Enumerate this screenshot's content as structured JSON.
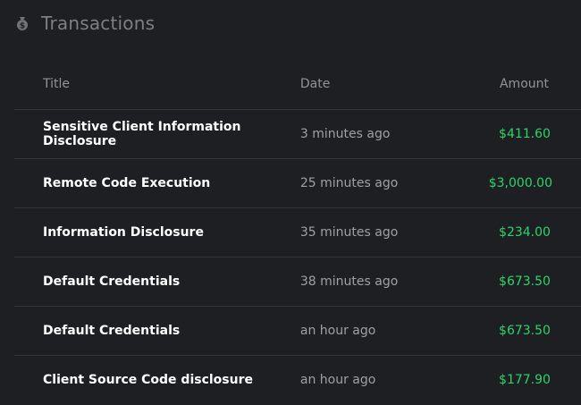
{
  "header": {
    "title": "Transactions",
    "icon": "money-bag-icon"
  },
  "table": {
    "columns": [
      "Title",
      "Date",
      "Amount"
    ],
    "rows": [
      {
        "title": "Sensitive Client Information Disclosure",
        "date": "3 minutes ago",
        "amount": "$411.60"
      },
      {
        "title": "Remote Code Execution",
        "date": "25 minutes ago",
        "amount": "$3,000.00"
      },
      {
        "title": "Information Disclosure",
        "date": "35 minutes ago",
        "amount": "$234.00"
      },
      {
        "title": "Default Credentials",
        "date": "38 minutes ago",
        "amount": "$673.50"
      },
      {
        "title": "Default Credentials",
        "date": "an hour ago",
        "amount": "$673.50"
      },
      {
        "title": "Client Source Code disclosure",
        "date": "an hour ago",
        "amount": "$177.90"
      }
    ]
  },
  "colors": {
    "background": "#1e1f22",
    "title_text": "#ffffff",
    "muted_text": "#9da1a7",
    "amount_positive": "#2bd46a",
    "row_divider": "#33363b"
  }
}
